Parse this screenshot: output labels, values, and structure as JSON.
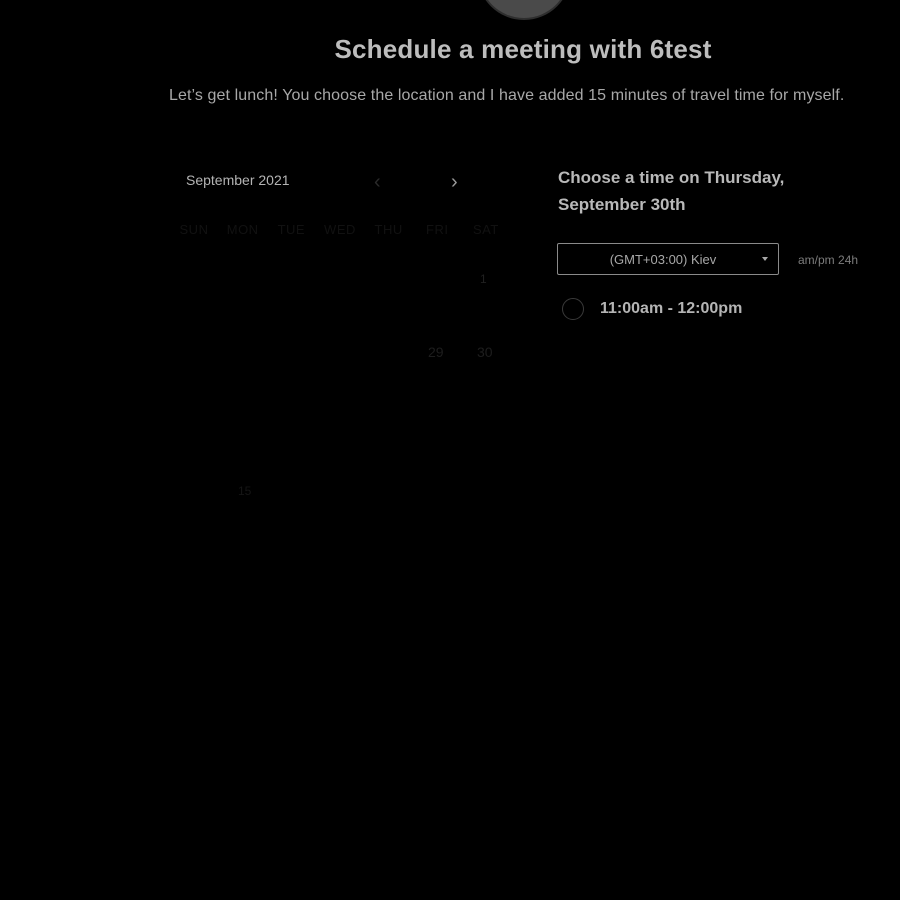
{
  "header": {
    "title": "Schedule a meeting with 6test",
    "description": "Let’s get lunch! You choose the location and I have added 15 minutes of travel time for myself."
  },
  "calendar": {
    "month_label": "September 2021",
    "prev_icon": "‹",
    "next_icon": "›",
    "weekdays": [
      "SUN",
      "MON",
      "TUE",
      "WED",
      "THU",
      "FRI",
      "SAT"
    ],
    "days": {
      "marker": "1",
      "d29": "29",
      "d30": "30",
      "oct": "15"
    }
  },
  "booking": {
    "choose_title": "Choose a time on Thursday, September 30th",
    "timezone": "(GMT+03:00) Kiev",
    "format_ampm": "am/pm",
    "format_24h": "24h",
    "slots": [
      {
        "label": "11:00am - 12:00pm"
      }
    ]
  },
  "colors": {
    "background": "#000000",
    "text": "#c9c9c9"
  }
}
